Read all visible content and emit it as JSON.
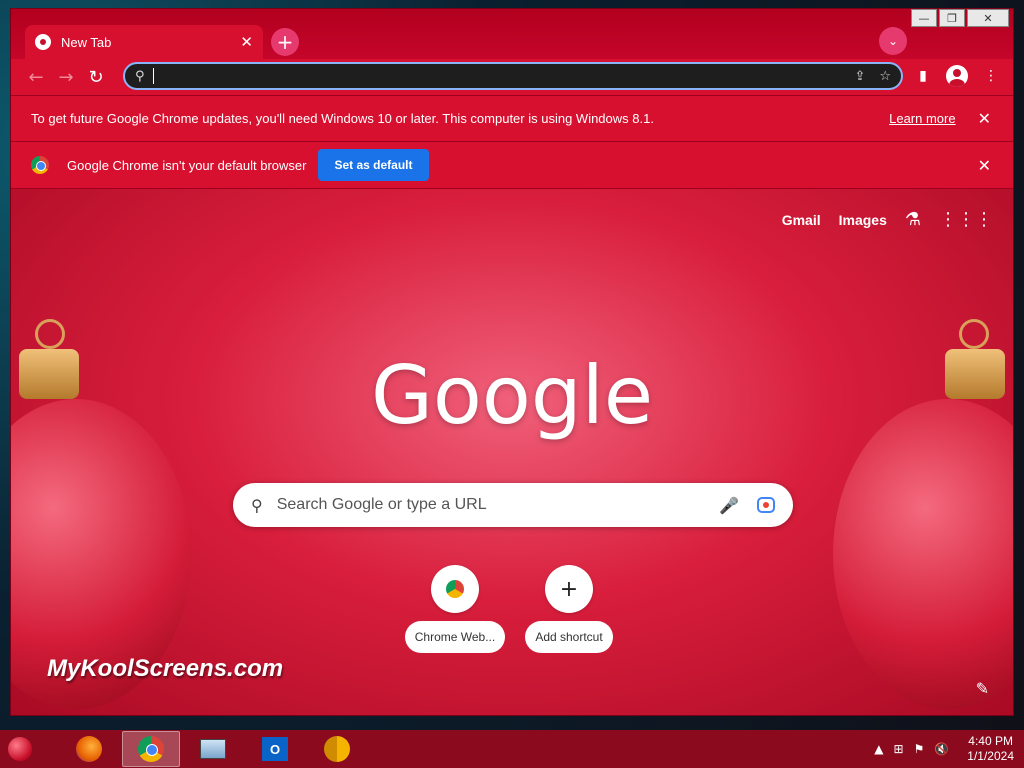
{
  "window": {
    "controls": {
      "minimize": "—",
      "maximize": "❐",
      "close": "✕"
    }
  },
  "tab": {
    "title": "New Tab",
    "close": "✕"
  },
  "tabstrip": {
    "new_tab": "+",
    "tab_search": "⌄"
  },
  "toolbar": {
    "back": "←",
    "forward": "→",
    "reload": "↻",
    "omnibox_value": "",
    "share": "⇪",
    "bookmark": "☆",
    "side_panel": "▮",
    "menu": "⋮"
  },
  "infobars": {
    "update": {
      "message": "To get future Google Chrome updates, you'll need Windows 10 or later. This computer is using Windows 8.1.",
      "link": "Learn more",
      "close": "✕"
    },
    "default_browser": {
      "message": "Google Chrome isn't your default browser",
      "button": "Set as default",
      "close": "✕"
    }
  },
  "ntp": {
    "top_links": {
      "gmail": "Gmail",
      "images": "Images",
      "labs": "⚗",
      "apps": "⋮⋮⋮"
    },
    "logo": "Google",
    "search_placeholder": "Search Google or type a URL",
    "search_icon": "⚲",
    "mic_icon": "🎤",
    "shortcuts": [
      {
        "label": "Chrome Web...",
        "icon": "chrome-icon"
      },
      {
        "label": "Add shortcut",
        "icon": "plus-icon",
        "glyph": "+"
      }
    ],
    "watermark": "MyKoolScreens.com",
    "edit_icon": "✎"
  },
  "taskbar": {
    "items": [
      "Firefox",
      "Google Chrome",
      "Resource Monitor",
      "Outlook",
      "Chrome Canary"
    ],
    "outlook_letter": "O",
    "tray": {
      "show_hidden": "▲",
      "network": "⊞",
      "flag": "⚑",
      "volume": "🔇"
    },
    "time": "4:40 PM",
    "date": "1/1/2024"
  },
  "colors": {
    "theme_red": "#c8102e",
    "accent_blue": "#1a73e8",
    "omnibox_focus": "#8ab4f8"
  }
}
